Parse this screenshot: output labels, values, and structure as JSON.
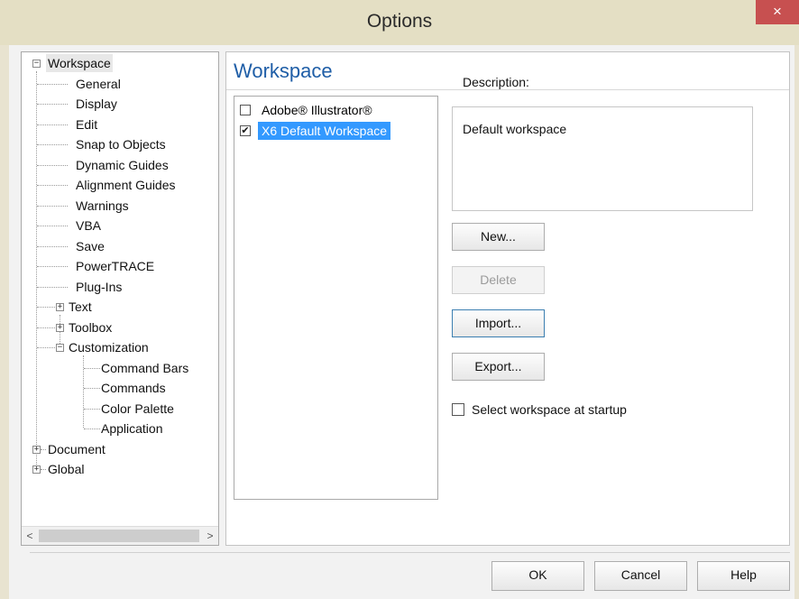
{
  "window": {
    "title": "Options",
    "close_glyph": "×"
  },
  "tree": {
    "items": [
      {
        "label": "Workspace",
        "expander": "−"
      },
      {
        "label": "General"
      },
      {
        "label": "Display"
      },
      {
        "label": "Edit"
      },
      {
        "label": "Snap to Objects"
      },
      {
        "label": "Dynamic Guides"
      },
      {
        "label": "Alignment Guides"
      },
      {
        "label": "Warnings"
      },
      {
        "label": "VBA"
      },
      {
        "label": "Save"
      },
      {
        "label": "PowerTRACE"
      },
      {
        "label": "Plug-Ins"
      },
      {
        "label": "Text",
        "expander": "+"
      },
      {
        "label": "Toolbox",
        "expander": "+"
      },
      {
        "label": "Customization",
        "expander": "−"
      },
      {
        "label": "Command Bars"
      },
      {
        "label": "Commands"
      },
      {
        "label": "Color Palette"
      },
      {
        "label": "Application"
      },
      {
        "label": "Document",
        "expander": "+"
      },
      {
        "label": "Global",
        "expander": "+"
      }
    ],
    "scroll_left": "<",
    "scroll_right": ">"
  },
  "panel": {
    "heading": "Workspace",
    "workspaces": [
      {
        "label": "Adobe® Illustrator®",
        "checked": false,
        "selected": false
      },
      {
        "label": "X6 Default Workspace",
        "checked": true,
        "selected": true
      }
    ],
    "description_label": "Description:",
    "description_text": "Default workspace",
    "buttons": {
      "new": "New...",
      "delete": "Delete",
      "import": "Import...",
      "export": "Export..."
    },
    "startup_label": "Select workspace at startup",
    "startup_checked": false
  },
  "footer": {
    "ok": "OK",
    "cancel": "Cancel",
    "help": "Help"
  },
  "colors": {
    "title_bar": "#e4dfc4",
    "close": "#c75050",
    "heading": "#1f5ea7",
    "selection": "#3399ff"
  }
}
